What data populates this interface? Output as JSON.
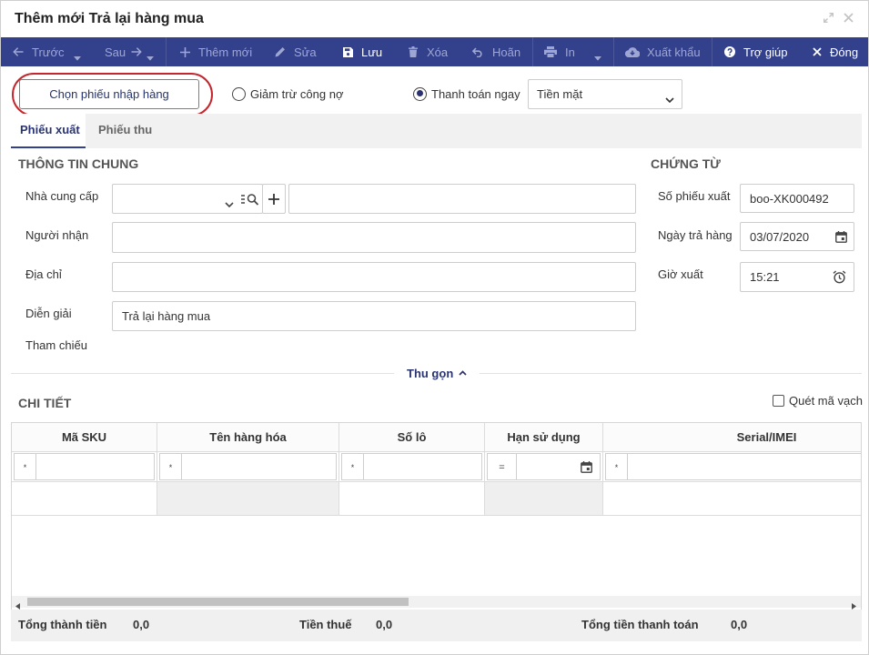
{
  "window": {
    "title": "Thêm mới Trả lại hàng mua"
  },
  "toolbar": {
    "prev": {
      "label": "Trước",
      "enabled": false
    },
    "next": {
      "label": "Sau",
      "enabled": false
    },
    "add": {
      "label": "Thêm mới",
      "enabled": false
    },
    "edit": {
      "label": "Sửa",
      "enabled": false
    },
    "save": {
      "label": "Lưu",
      "enabled": true
    },
    "delete": {
      "label": "Xóa",
      "enabled": false
    },
    "defer": {
      "label": "Hoãn",
      "enabled": false
    },
    "print": {
      "label": "In",
      "enabled": false
    },
    "export": {
      "label": "Xuất khẩu",
      "enabled": false
    },
    "help": {
      "label": "Trợ giúp",
      "enabled": true
    },
    "close": {
      "label": "Đóng",
      "enabled": true
    }
  },
  "options": {
    "choose_receipt": "Chọn phiếu nhập hàng",
    "debt_deduction_label": "Giảm trừ công nợ",
    "debt_deduction_selected": false,
    "pay_now_label": "Thanh toán ngay",
    "pay_now_selected": true,
    "payment_method": "Tiền mặt"
  },
  "tabs": [
    {
      "label": "Phiếu xuất",
      "active": true
    },
    {
      "label": "Phiếu thu",
      "active": false
    }
  ],
  "general": {
    "heading": "THÔNG TIN CHUNG",
    "supplier_label": "Nhà cung cấp",
    "receiver_label": "Người nhận",
    "address_label": "Địa chỉ",
    "description_label": "Diễn giải",
    "description_value": "Trả lại hàng mua",
    "reference_label": "Tham chiếu"
  },
  "voucher": {
    "heading": "CHỨNG TỪ",
    "number_label": "Số phiếu xuất",
    "number_value": "boo-XK000492",
    "date_label": "Ngày trả hàng",
    "date_value": "03/07/2020",
    "time_label": "Giờ xuất",
    "time_value": "15:21"
  },
  "collapse_label": "Thu gọn",
  "detail": {
    "heading": "CHI TIẾT",
    "barcode_scan_label": "Quét mã vạch",
    "barcode_scan_checked": false,
    "columns": [
      "Mã SKU",
      "Tên hàng hóa",
      "Số lô",
      "Hạn sử dụng",
      "Serial/IMEI"
    ],
    "filter_operators": [
      "*",
      "*",
      "*",
      "=",
      "*"
    ]
  },
  "totals": {
    "subtotal_label": "Tổng thành tiền",
    "subtotal_value": "0,0",
    "tax_label": "Tiền thuế",
    "tax_value": "0,0",
    "grand_total_label": "Tổng tiền thanh toán",
    "grand_total_value": "0,0"
  },
  "colors": {
    "toolbar_bg": "#33408c",
    "accent": "#2a3470",
    "annotation": "#c4262e",
    "disabled_text": "#9ea6d4"
  }
}
